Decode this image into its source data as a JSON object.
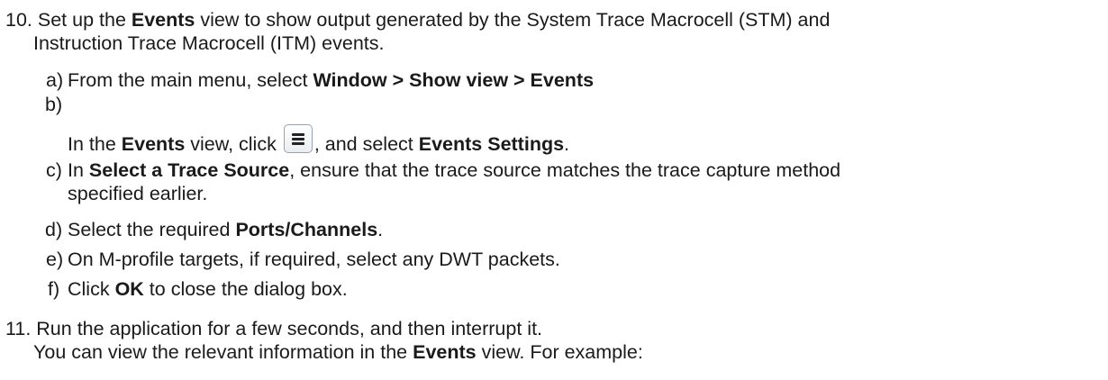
{
  "steps": [
    {
      "number": "10.",
      "line1": {
        "pre": "Set up the ",
        "bold": "Events",
        "post": " view to show output generated by the System Trace Macrocell (STM) and"
      },
      "line2": "Instruction Trace Macrocell (ITM) events.",
      "substeps": {
        "a": {
          "letter": "a)",
          "pre": "From the main menu, select ",
          "bold": "Window > Show view > Events"
        },
        "b": {
          "letter": "b)",
          "pre": "In the ",
          "bold1": "Events",
          "mid": " view, click ",
          "post": ", and select ",
          "bold2": "Events Settings",
          "end": ".",
          "icon": "view-menu-icon"
        },
        "c": {
          "letter": "c)",
          "pre": "In ",
          "bold": "Select a Trace Source",
          "post": ", ensure that the trace source matches the trace capture method",
          "line2": "specified earlier."
        },
        "d": {
          "letter": "d)",
          "pre": "Select the required ",
          "bold": "Ports/Channels",
          "post": "."
        },
        "e": {
          "letter": "e)",
          "text": "On M-profile targets, if required, select any DWT packets."
        },
        "f": {
          "letter": "f)",
          "pre": "Click ",
          "bold": "OK",
          "post": " to close the dialog box."
        }
      }
    },
    {
      "number": "11.",
      "line1": "Run the application for a few seconds, and then interrupt it.",
      "line2": {
        "pre": "You can view the relevant information in the ",
        "bold": "Events",
        "post": " view. For example:"
      }
    }
  ]
}
